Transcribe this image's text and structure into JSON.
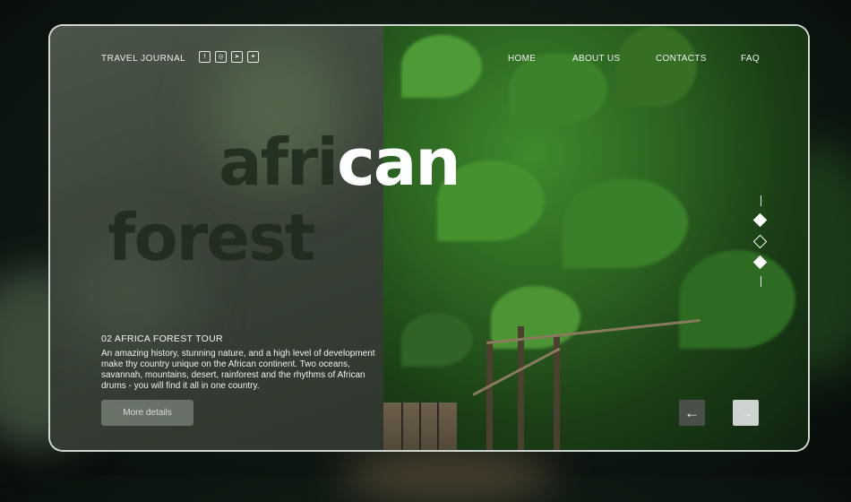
{
  "header": {
    "brand": "TRAVEL JOURNAL",
    "socials": [
      {
        "icon": "facebook-icon",
        "glyph": "f"
      },
      {
        "icon": "instagram-icon",
        "glyph": "◎"
      },
      {
        "icon": "telegram-icon",
        "glyph": "➤"
      },
      {
        "icon": "twitter-icon",
        "glyph": "✦"
      }
    ],
    "nav": [
      "HOME",
      "ABOUT US",
      "CONTACTS",
      "FAQ"
    ]
  },
  "hero": {
    "word1_dark": "afri",
    "word1_light": "can",
    "word2": "forest"
  },
  "pager": {
    "total": 3,
    "active": [
      1,
      3
    ]
  },
  "tour": {
    "title": "02 AFRICA FOREST TOUR",
    "description": "An amazing history, stunning nature, and a high level of development make thy country unique on the African continent. Two oceans, savannah, mountains, desert, rainforest and the rhythms of African drums - you will find it all in one country.",
    "button": "More details"
  },
  "controls": {
    "prev": "←",
    "next": "→"
  },
  "colors": {
    "accent": "#ffffff",
    "button_dark": "#3a3f3a",
    "button_light": "#d9dcd9"
  }
}
